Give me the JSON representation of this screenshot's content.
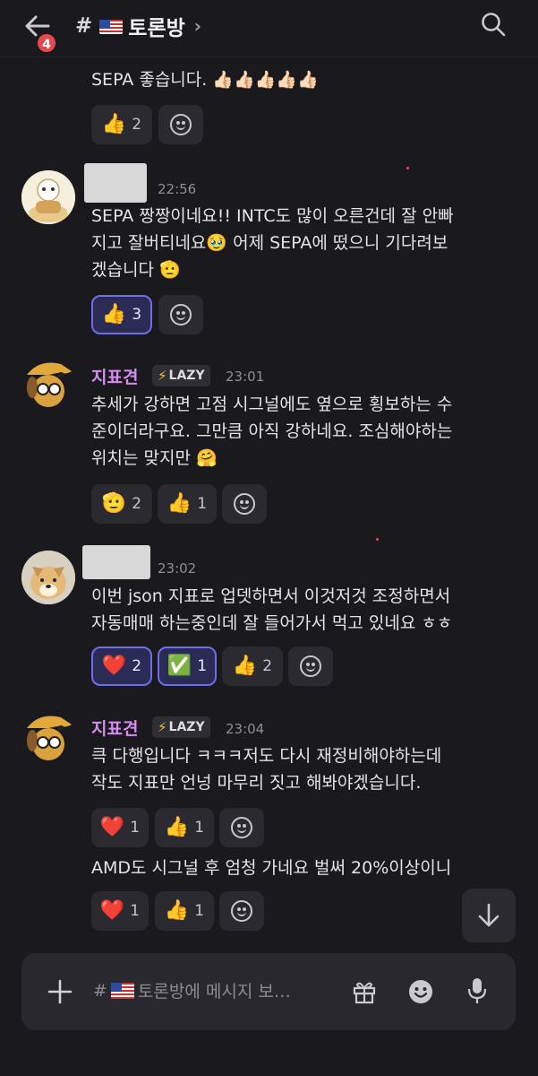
{
  "header": {
    "back_badge": "4",
    "hash": "#",
    "channel_name": "토론방",
    "chevron": "›",
    "icons": {
      "back": "arrow-left-icon",
      "search": "search-icon",
      "flag": "us-flag-icon"
    }
  },
  "messages": [
    {
      "text": "SEPA 좋습니다. 👍🏻👍🏻👍🏻👍🏻👍🏻",
      "reactions": [
        {
          "emoji": "👍",
          "count": "2",
          "active": false
        }
      ]
    },
    {
      "time": "22:56",
      "text_lines": [
        "SEPA 짱짱이네요!! INTC도 많이 오른건데 잘 안빠",
        "지고 잘버티네요🥹 어제 SEPA에 떴으니 기다려보",
        "겠습니다 🫡"
      ],
      "reactions": [
        {
          "emoji": "👍",
          "count": "3",
          "active": true
        }
      ]
    },
    {
      "username": "지표견",
      "role": "LAZY",
      "role_icon": "⚡",
      "time": "23:01",
      "text_lines": [
        "추세가 강하면 고점 시그널에도 옆으로 횡보하는 수",
        "준이더라구요. 그만큼 아직 강하네요. 조심해야하는",
        "위치는 맞지만 🤗"
      ],
      "reactions": [
        {
          "emoji": "🫡",
          "count": "2",
          "active": false
        },
        {
          "emoji": "👍",
          "count": "1",
          "active": false
        }
      ]
    },
    {
      "time": "23:02",
      "text_lines": [
        "이번 json 지표로 업뎃하면서 이것저것 조정하면서",
        "자동매매 하는중인데 잘 들어가서 먹고 있네요 ㅎㅎ"
      ],
      "reactions": [
        {
          "emoji": "❤️",
          "count": "2",
          "active": true
        },
        {
          "emoji": "✅",
          "count": "1",
          "active": true
        },
        {
          "emoji": "👍",
          "count": "2",
          "active": false
        }
      ]
    },
    {
      "username": "지표견",
      "role": "LAZY",
      "role_icon": "⚡",
      "time": "23:04",
      "text_lines": [
        "큭 다행입니다 ㅋㅋㅋ저도 다시 재정비해야하는데",
        "작도 지표만 언넝 마무리 짓고 해봐야겠습니다."
      ],
      "reactions": [
        {
          "emoji": "❤️",
          "count": "1",
          "active": false
        },
        {
          "emoji": "👍",
          "count": "1",
          "active": false
        }
      ]
    },
    {
      "text": "AMD도 시그널 후 엄청 가네요 벌써 20%이상이니",
      "reactions": [
        {
          "emoji": "❤️",
          "count": "1",
          "active": false
        },
        {
          "emoji": "👍",
          "count": "1",
          "active": false
        }
      ]
    }
  ],
  "composer": {
    "placeholder_prefix": "#",
    "placeholder_channel": "토론방에 메시지 보…",
    "icons": {
      "plus": "plus-icon",
      "gift": "gift-icon",
      "emoji": "emoji-icon",
      "mic": "microphone-icon"
    }
  },
  "colors": {
    "background": "#1a1a1e",
    "username": "#d88cf0",
    "active_reaction_border": "#6c6fe6",
    "badge": "#e5484d"
  }
}
